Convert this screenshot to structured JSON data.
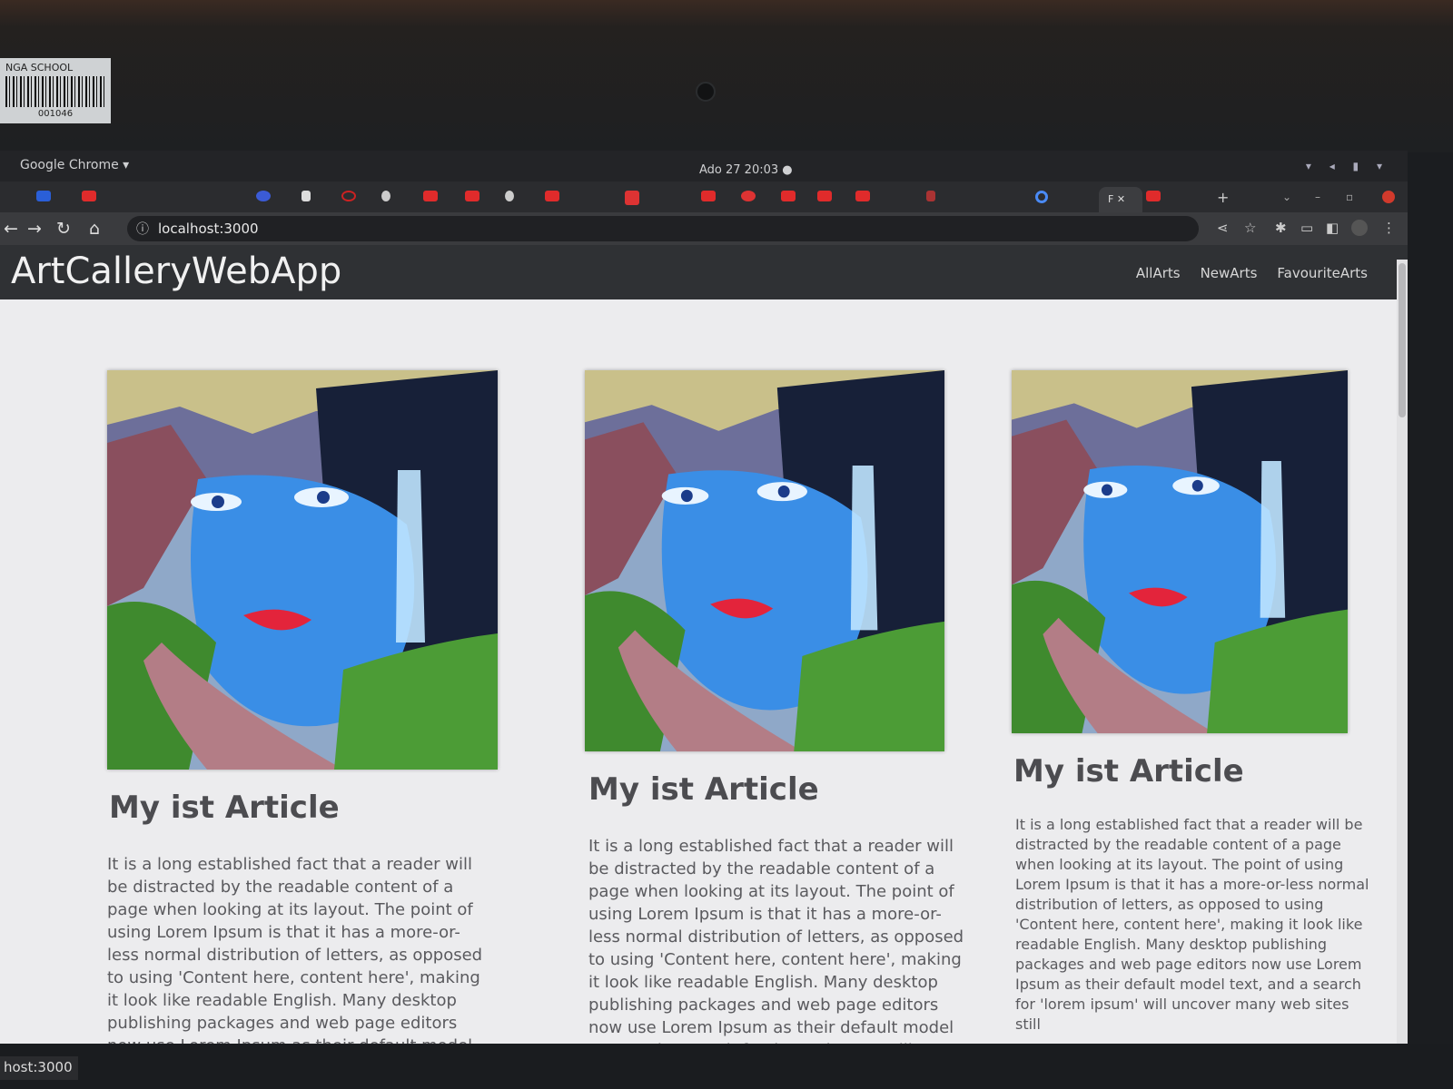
{
  "sticker": {
    "text": "NGA SCHOOL",
    "code": "001046"
  },
  "system_bar": {
    "app_name": "Google Chrome ▾",
    "clock": "Ado 27  20:03  ●"
  },
  "tabs": {
    "active_tab_label": "F ✕",
    "new_tab": "+"
  },
  "address_bar": {
    "url": "localhost:3000",
    "info_icon": "ⓘ"
  },
  "app": {
    "brand": "ArtCalleryWebApp",
    "nav": [
      "AllArts",
      "NewArts",
      "FavouriteArts"
    ]
  },
  "articles": [
    {
      "title": "My ist Article",
      "body": "It is a long established fact that a reader will be distracted by the readable content of a page when looking at its layout. The point of using Lorem Ipsum is that it has a more-or-less normal distribution of letters, as opposed to using 'Content here, content here', making it look like readable English. Many desktop publishing packages and web page editors now use Lorem Ipsum as their default model text, and a search for 'lorem ipsum' will uncover many web sites still"
    },
    {
      "title": "My ist Article",
      "body": "It is a long established fact that a reader will be distracted by the readable content of a page when looking at its layout. The point of using Lorem Ipsum is that it has a more-or-less normal distribution of letters, as opposed to using 'Content here, content here', making it look like readable English. Many desktop publishing packages and web page editors now use Lorem Ipsum as their default model text, and a search for 'lorem ipsum' will uncover many web sites still"
    },
    {
      "title": "My ist Article",
      "body": "It is a long established fact that a reader will be distracted by the readable content of a page when looking at its layout. The point of using Lorem Ipsum is that it has a more-or-less normal distribution of letters, as opposed to using 'Content here, content here', making it look like readable English. Many desktop publishing packages and web page editors now use Lorem Ipsum as their default model text, and a search for 'lorem ipsum' will uncover many web sites still"
    }
  ],
  "status_bar": {
    "text": "host:3000"
  }
}
